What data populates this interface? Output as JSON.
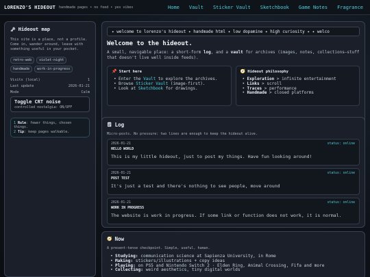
{
  "topbar": {
    "brand": "LORENZO'S HIDEOUT",
    "tagline": "handmade pages • no feed • yes vibes",
    "nav": [
      "Home",
      "Vault",
      "Sticker Vault",
      "Sketchbook",
      "Game Notes",
      "Fragrance"
    ]
  },
  "sidebar": {
    "title": "Hideout map",
    "description": "This site is a place, not a profile. Come in, wander around, leave with something useful in your pocket.",
    "tags": [
      "retro-web",
      "violet-night",
      "handmade",
      "work-in-progress"
    ],
    "visits_label": "Visits (local)",
    "visits_value": "1",
    "last_update_label": "Last update",
    "last_update_value": "2026-01-21",
    "mode_label": "Mode",
    "mode_value": "Calm",
    "crt_title": "Toggle CRT noise",
    "crt_sub": "controlled nostalgia: ON/OFF",
    "rule1_num": "1",
    "rule1_key": "Rule",
    "rule1_text": ": fewer things, chosen things.",
    "rule2_num": "2",
    "rule2_key": "Tip",
    "rule2_text": ": keep pages walkable."
  },
  "hero": {
    "ticker": "✦ welcome to lorenzo's hideout ✦ handmade html ✦ low dopamine ✦ high curiosity ✦ ✦ welco",
    "title": "Welcome to the hideout.",
    "intro_a": "A small, navigable place: a short-form ",
    "intro_log": "log",
    "intro_b": ", and a ",
    "intro_vault": "vault",
    "intro_c": " for archives (images, notes, collections—stuff that doesn't live well inside feeds).",
    "start": {
      "title": "Start here",
      "i1a": "Enter the ",
      "i1link": "Vault",
      "i1b": " to explore the archives.",
      "i2a": "Browse ",
      "i2link": "Sticker Vault",
      "i2b": " (image-first).",
      "i3a": "Look at ",
      "i3link": "Sketchbook",
      "i3b": " for drawings."
    },
    "philosophy": {
      "title": "Hideout philosophy",
      "items": [
        {
          "key": "Exploration",
          "rest": " > infinite entertainment"
        },
        {
          "key": "Links",
          "rest": " > scroll"
        },
        {
          "key": "Traces",
          "rest": " > performance"
        },
        {
          "key": "Handmade",
          "rest": " > closed platforms"
        }
      ]
    }
  },
  "log": {
    "title": "Log",
    "subtitle": "Micro-posts. No pressure: two lines are enough to keep the hideout alive.",
    "entries": [
      {
        "date": "2026-01-21",
        "status": "status: online",
        "title": "HELLO WORLD",
        "body": "This is my little hideout, just to post my things. Have fun looking around!"
      },
      {
        "date": "2026-01-21",
        "status": "status: online",
        "title": "POST TEST",
        "body": "It's just a test and there's nothing to see people, move around"
      },
      {
        "date": "2026-01-21",
        "status": "status: online",
        "title": "WORK IN PROGRESS",
        "body": "The website is work in progress. If some link or function does not work, it is normal."
      }
    ]
  },
  "now": {
    "title": "Now",
    "subtitle": "A present-tense checkpoint. Simple, useful, human.",
    "items": [
      {
        "key": "Studying:",
        "rest": " communication science at Sapienza University, in Rome"
      },
      {
        "key": "Making:",
        "rest": " stickers/illustrations + copy ideas"
      },
      {
        "key": "Playing:",
        "rest": " on PS5 and Nintendo Switch 2 · Elden Ring, Animal Crossing, Fifa and more"
      },
      {
        "key": "Collecting:",
        "rest": " weird aesthetics, tiny digital worlds"
      }
    ]
  },
  "colors": {
    "accent": "#4fd1e0",
    "panel": "#1a1f2a",
    "background": "#0e1218"
  }
}
